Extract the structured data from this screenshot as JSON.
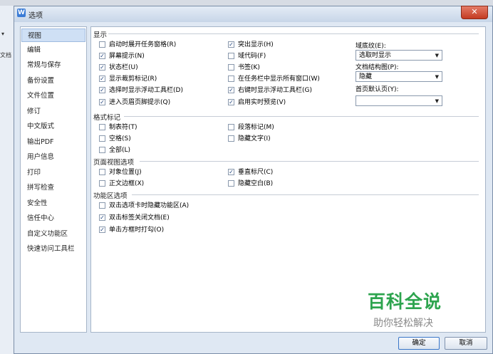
{
  "background": {
    "left_strip_label": "文档"
  },
  "dialog": {
    "title": "选项",
    "app_icon_glyph": "W",
    "close_glyph": "✕"
  },
  "nav": {
    "items": [
      "视图",
      "编辑",
      "常规与保存",
      "备份设置",
      "文件位置",
      "修订",
      "中文版式",
      "输出PDF",
      "用户信息",
      "打印",
      "拼写检查",
      "安全性",
      "信任中心",
      "自定义功能区",
      "快速访问工具栏"
    ],
    "selected_index": 0
  },
  "sections": {
    "display": {
      "title": "显示"
    },
    "format_marks": {
      "title": "格式标记"
    },
    "page_view": {
      "title": "页面视图选项"
    },
    "ribbon": {
      "title": "功能区选项"
    }
  },
  "display_options": [
    {
      "label": "启动时展开任务窗格(R)",
      "checked": false
    },
    {
      "label": "屏幕提示(N)",
      "checked": true
    },
    {
      "label": "状态栏(U)",
      "checked": true
    },
    {
      "label": "显示裁剪标记(R)",
      "checked": true
    },
    {
      "label": "选择时显示浮动工具栏(D)",
      "checked": true
    },
    {
      "label": "进入页眉页脚提示(Q)",
      "checked": true
    },
    {
      "label": "突出显示(H)",
      "checked": true
    },
    {
      "label": "域代码(F)",
      "checked": false
    },
    {
      "label": "书签(K)",
      "checked": false
    },
    {
      "label": "在任务栏中显示所有窗口(W)",
      "checked": false
    },
    {
      "label": "右键时显示浮动工具栏(G)",
      "checked": true
    },
    {
      "label": "启用实时预览(V)",
      "checked": true
    }
  ],
  "right_fields": {
    "field_shading": {
      "label": "域底纹(E):",
      "value": "选取时显示"
    },
    "doc_structure": {
      "label": "文档结构图(P):",
      "value": "隐藏"
    },
    "first_page": {
      "label": "首页默认页(Y):",
      "value": ""
    }
  },
  "format_mark_options": [
    {
      "label": "制表符(T)",
      "checked": false
    },
    {
      "label": "空格(S)",
      "checked": false
    },
    {
      "label": "全部(L)",
      "checked": false
    },
    {
      "label": "段落标记(M)",
      "checked": false
    },
    {
      "label": "隐藏文字(I)",
      "checked": false
    }
  ],
  "page_view_options": [
    {
      "label": "对象位置(J)",
      "checked": false
    },
    {
      "label": "正文边框(X)",
      "checked": false
    },
    {
      "label": "垂直标尺(C)",
      "checked": true
    },
    {
      "label": "隐藏空白(B)",
      "checked": false
    }
  ],
  "ribbon_options": [
    {
      "label": "双击选项卡时隐藏功能区(A)",
      "checked": false
    },
    {
      "label": "双击标签关闭文档(E)",
      "checked": true
    },
    {
      "label": "单击方框时打勾(O)",
      "checked": true
    }
  ],
  "watermark": {
    "main": "百科全说",
    "sub": "助你轻松解决"
  },
  "buttons": {
    "ok": "确定",
    "cancel": "取消"
  },
  "colors": {
    "watermark_green": "#2da44e",
    "selected_nav": "#cfe0f5",
    "dialog_bg": "#dfe8f3"
  }
}
